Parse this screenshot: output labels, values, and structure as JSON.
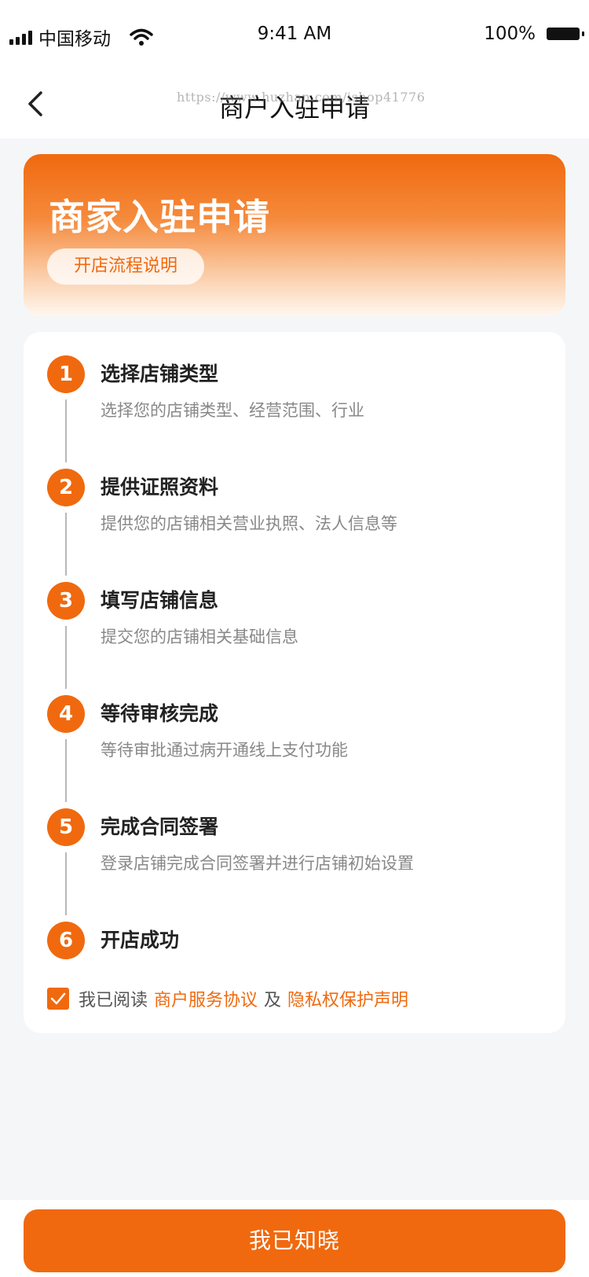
{
  "status_bar": {
    "carrier": "中国移动",
    "time": "9:41 AM",
    "battery": "100%"
  },
  "nav": {
    "title": "商户入驻申请",
    "watermark": "https://www.huzhan.com/ishop41776"
  },
  "banner": {
    "title": "商家入驻申请",
    "button_label": "开店流程说明"
  },
  "steps": [
    {
      "number": "1",
      "title": "选择店铺类型",
      "desc": "选择您的店铺类型、经营范围、行业"
    },
    {
      "number": "2",
      "title": "提供证照资料",
      "desc": "提供您的店铺相关营业执照、法人信息等"
    },
    {
      "number": "3",
      "title": "填写店铺信息",
      "desc": "提交您的店铺相关基础信息"
    },
    {
      "number": "4",
      "title": "等待审核完成",
      "desc": "等待审批通过病开通线上支付功能"
    },
    {
      "number": "5",
      "title": "完成合同签署",
      "desc": "登录店铺完成合同签署并进行店铺初始设置"
    },
    {
      "number": "6",
      "title": "开店成功",
      "desc": ""
    }
  ],
  "agreement": {
    "checked": true,
    "prefix": "我已阅读",
    "link1": "商户服务协议",
    "separator": "及",
    "link2": "隐私权保护声明"
  },
  "footer": {
    "confirm_label": "我已知晓"
  },
  "colors": {
    "accent": "#f0690e",
    "background": "#f5f6f8"
  },
  "icons": {
    "back": "chevron-left-icon",
    "wifi": "wifi-icon",
    "signal": "signal-icon",
    "battery": "battery-icon",
    "check": "check-icon"
  }
}
